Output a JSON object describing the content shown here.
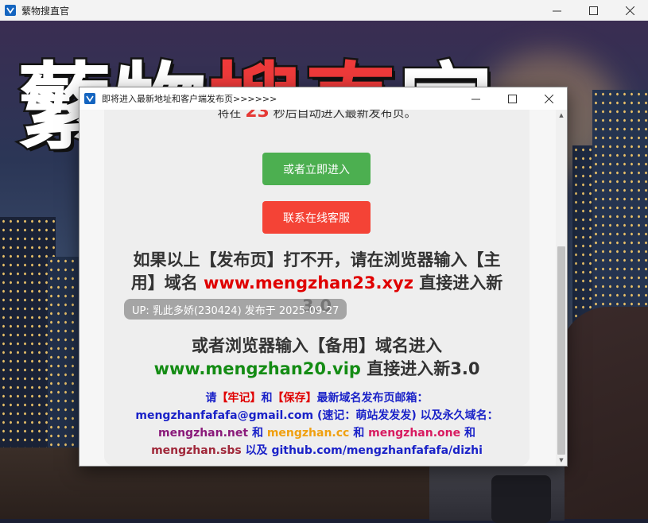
{
  "main_window": {
    "title": "蘩物搜直官",
    "controls": {
      "minimize": "minimize-icon",
      "maximize": "maximize-icon",
      "close": "close-icon"
    }
  },
  "background": {
    "title_part1": "蘩物",
    "title_part2": "搜直",
    "title_part3": "官"
  },
  "popup": {
    "title": "即将进入最新地址和客户端发布页>>>>>>",
    "countdown": {
      "prefix": "将在",
      "seconds": "23",
      "suffix": "秒后自动进入最新发布页。"
    },
    "enter_button": "或者立即进入",
    "support_button": "联系在线客服",
    "para1": {
      "text_a": "如果以上【发布页】打不开，请在浏览器输入【主用】域名",
      "domain": "www.mengzhan23.xyz",
      "text_b": "直接进入新3.0"
    },
    "para2": {
      "text_a": "或者浏览器输入【备用】域名进入",
      "domain": "www.mengzhan20.vip",
      "text_b": "直接进入新3.0"
    },
    "para3": {
      "t1": "请",
      "remember": "【牢记】",
      "t2": "和",
      "save": "【保存】",
      "t3": "最新域名发布页邮箱：",
      "email": "mengzhanfafafa@gmail.com",
      "t4": "(速记：萌站发发发) 以及永久域名：",
      "d1": "mengzhan.net",
      "and1": "和",
      "d2": "mengzhan.cc",
      "and2": "和",
      "d3": "mengzhan.one",
      "and3": "和",
      "d4": "mengzhan.sbs",
      "t5": "以及",
      "github": "github.com/mengzhanfafafa/dizhi"
    }
  },
  "overlay_caption": "UP: 乳此多娇(230424) 发布于 2025-09-27",
  "colors": {
    "green_button": "#4caf50",
    "red_button": "#f44336",
    "primary_domain": "#e00000",
    "backup_domain": "#148c14",
    "notice_blue": "#1a22c8"
  }
}
